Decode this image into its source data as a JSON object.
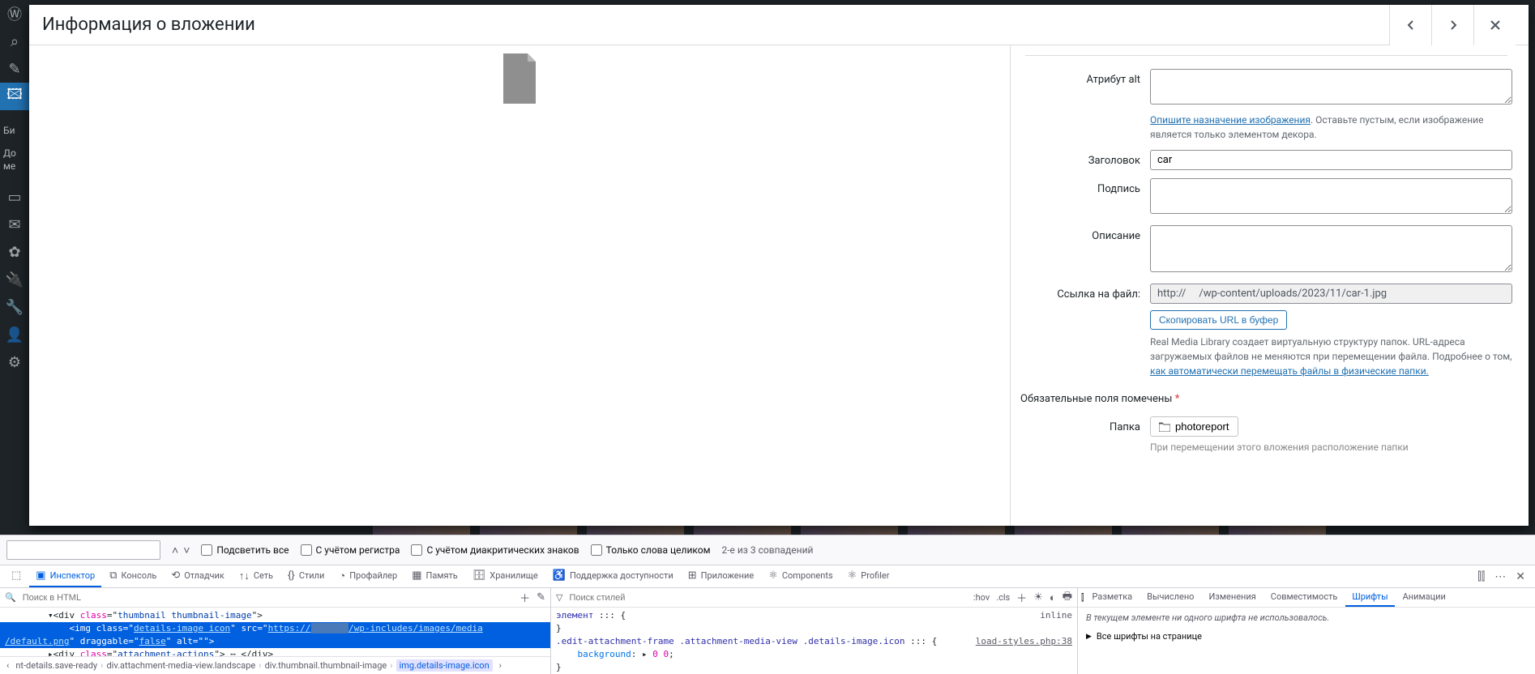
{
  "modal": {
    "title": "Информация о вложении",
    "fields": {
      "alt_label": "Атрибут alt",
      "alt_value": "",
      "alt_help_link": "Опишите назначение изображения",
      "alt_help_rest": ". Оставьте пустым, если изображение является только элементом декора.",
      "title_label": "Заголовок",
      "title_value": "car",
      "caption_label": "Подпись",
      "caption_value": "",
      "description_label": "Описание",
      "description_value": "",
      "fileurl_label": "Ссылка на файл:",
      "fileurl_value": "http://      /wp-content/uploads/2023/11/car-1.jpg",
      "copy_url_btn": "Скопировать URL в буфер",
      "rml_note_1": "Real Media Library создает виртуальную структуру папок. URL-адреса загружаемых файлов не меняются при перемещении файла. Подробнее о том, ",
      "rml_note_link": "как автоматически перемещать файлы в физические папки.",
      "required_note": "Обязательные поля помечены ",
      "folder_label": "Папка",
      "folder_value": "photoreport",
      "move_note": "При перемещении этого вложения расположение папки"
    }
  },
  "findbar": {
    "placeholder": "",
    "highlight_all": "Подсветить все",
    "match_case": "С учётом регистра",
    "diacritics": "С учётом диакритических знаков",
    "whole_words": "Только слова целиком",
    "status": "2-е из 3 совпадений"
  },
  "devtools": {
    "tabs": {
      "inspector": "Инспектор",
      "console": "Консоль",
      "debugger": "Отладчик",
      "network": "Сеть",
      "styles": "Стили",
      "profiler": "Профайлер",
      "memory": "Память",
      "storage": "Хранилище",
      "accessibility": "Поддержка доступности",
      "application": "Приложение",
      "components": "Components",
      "profiler2": "Profiler"
    },
    "html_search_placeholder": "Поиск в HTML",
    "html": {
      "line1_pre": "        ▾<div ",
      "line1_class": "thumbnail thumbnail-image",
      "line2_pre": "            <img ",
      "line2_class": "details-image icon",
      "line2_src1": "https://",
      "line2_src2": "/wp-includes/images/media",
      "line3_src3": "/default.png",
      "line3_drag": "false",
      "line3_alt": "",
      "line4_pre": "        ▸<div ",
      "line4_class": "attachment-actions",
      "line4_end": "> ⋯ </div>"
    },
    "crumbs": {
      "c1": "nt-details.save-ready",
      "c2": "div.attachment-media-view.landscape",
      "c3": "div.thumbnail.thumbnail-image",
      "c4": "img.details-image.icon"
    },
    "css_search_placeholder": "Поиск стилей",
    "css_hov": ":hov",
    "css_cls": ".cls",
    "css": {
      "sel1": "элемент",
      "inline": "inline",
      "rule_sel": ".edit-attachment-frame .attachment-media-view .details-image.icon",
      "rule_src": "load-styles.php:38",
      "prop1": "background",
      "val1": "0 0"
    },
    "right_tabs": {
      "layout": "Разметка",
      "computed": "Вычислено",
      "changes": "Изменения",
      "compat": "Совместимость",
      "fonts": "Шрифты",
      "anim": "Анимации"
    },
    "fonts_empty": "В текущем элементе ни одного шрифта не использовалось.",
    "fonts_all": "Все шрифты на странице"
  },
  "sidebar_labels": {
    "lib": "Би",
    "add": "До",
    "me": "ме"
  }
}
